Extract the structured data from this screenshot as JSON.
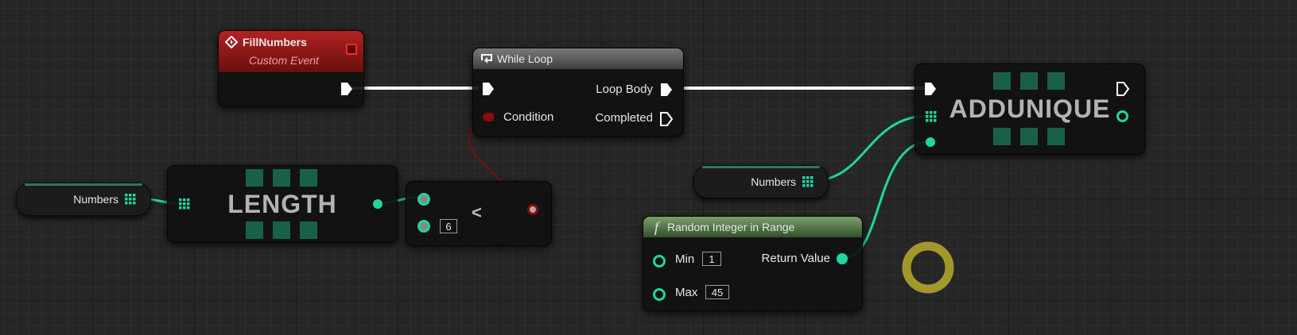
{
  "graph": {
    "fill_numbers": {
      "title": "FillNumbers",
      "subtitle": "Custom Event",
      "header_color": "#a11a1a"
    },
    "while_loop": {
      "title": "While Loop",
      "condition_label": "Condition",
      "loop_body_label": "Loop Body",
      "completed_label": "Completed"
    },
    "length_node": {
      "title": "LENGTH",
      "input_variable": "Numbers"
    },
    "less_than_node": {
      "operator": "<",
      "b_value": "6"
    },
    "add_unique_node": {
      "title": "ADDUNIQUE",
      "array_variable": "Numbers"
    },
    "random_int_node": {
      "title": "Random Integer in Range",
      "function_icon": "f",
      "min_label": "Min",
      "min_value": "1",
      "max_label": "Max",
      "max_value": "45",
      "return_label": "Return Value"
    },
    "colors": {
      "integer_pin": "#1fd6a1",
      "boolean_pin": "#8c0a0a",
      "exec_pin": "#ffffff",
      "reroute_highlight": "#c2b62a"
    },
    "icons": {
      "event": "event-diamond-icon",
      "loop": "loop-icon",
      "function": "function-icon",
      "array": "array-grid-icon"
    }
  }
}
